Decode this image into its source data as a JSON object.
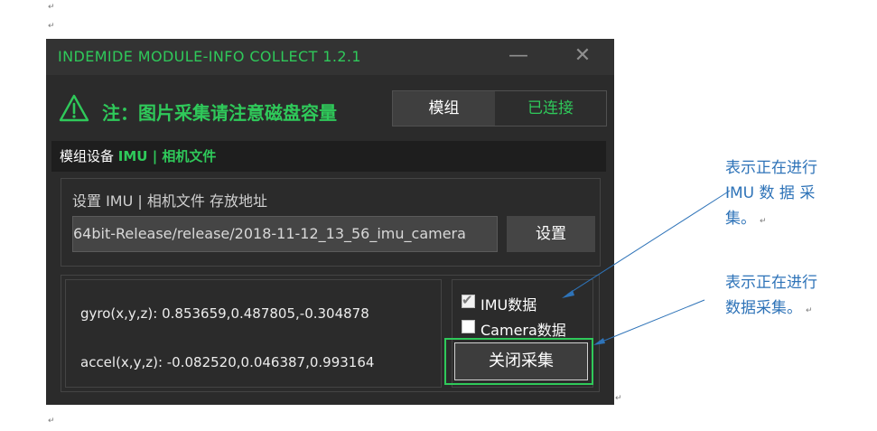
{
  "page": {
    "paragraph_mark": "↵"
  },
  "window": {
    "title": "INDEMIDE  MODULE-INFO COLLECT 1.2.1",
    "minimize_glyph": "—",
    "close_glyph": "✕"
  },
  "notice": {
    "icon": "warning-triangle-icon",
    "text": "注：图片采集请注意磁盘容量"
  },
  "module": {
    "label": "模组",
    "status": "已连接"
  },
  "section": {
    "prefix": "模组设备 ",
    "highlight": "IMU | 相机文件"
  },
  "path": {
    "label": "设置 IMU | 相机文件 存放地址",
    "value": "64bit-Release/release/2018-11-12_13_56_imu_camera",
    "set_button": "设置"
  },
  "readout": {
    "gyro": "gyro(x,y,z): 0.853659,0.487805,-0.304878",
    "accel": "accel(x,y,z): -0.082520,0.046387,0.993164"
  },
  "options": [
    {
      "label": "IMU数据",
      "checked": true
    },
    {
      "label": "Camera数据",
      "checked": false
    }
  ],
  "stop_button": "关闭采集",
  "annotations": {
    "imu_note_line1": "表示正在进行",
    "imu_note_line2": "IMU  数 据 采",
    "imu_note_line3": "集。",
    "data_note_line1": "表示正在进行",
    "data_note_line2": "数据采集。"
  },
  "colors": {
    "accent_green": "#2fc95a",
    "window_bg": "#2b2b2b",
    "annotation_blue": "#2e73b8"
  }
}
